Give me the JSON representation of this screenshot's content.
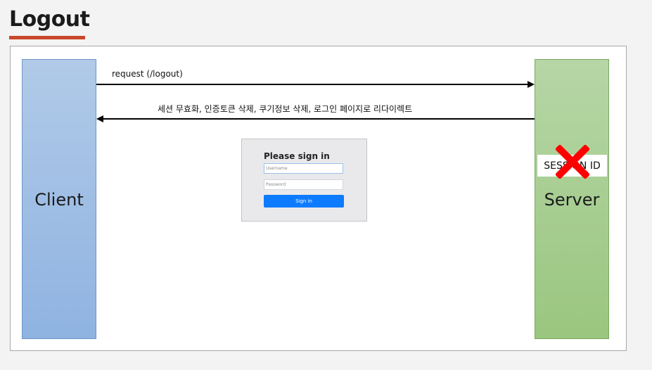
{
  "title": "Logout",
  "client_label": "Client",
  "server_label": "Server",
  "request_label": "request (/logout)",
  "response_label": "세션 무효화,  인증토큰 삭제, 쿠기정보 삭제, 로그인 페이지로 리다이렉트",
  "login_form": {
    "title": "Please sign in",
    "username_placeholder": "Username",
    "password_placeholder": "Password",
    "button_label": "Sign in",
    "button_color": "#0d7bff"
  },
  "session": {
    "label": "SESSION ID",
    "status_icon": "red-x-icon",
    "status_color": "#ff0000"
  },
  "colors": {
    "client": "#9dbde6",
    "server": "#a8cf92",
    "title_underline": "#c9472b"
  }
}
